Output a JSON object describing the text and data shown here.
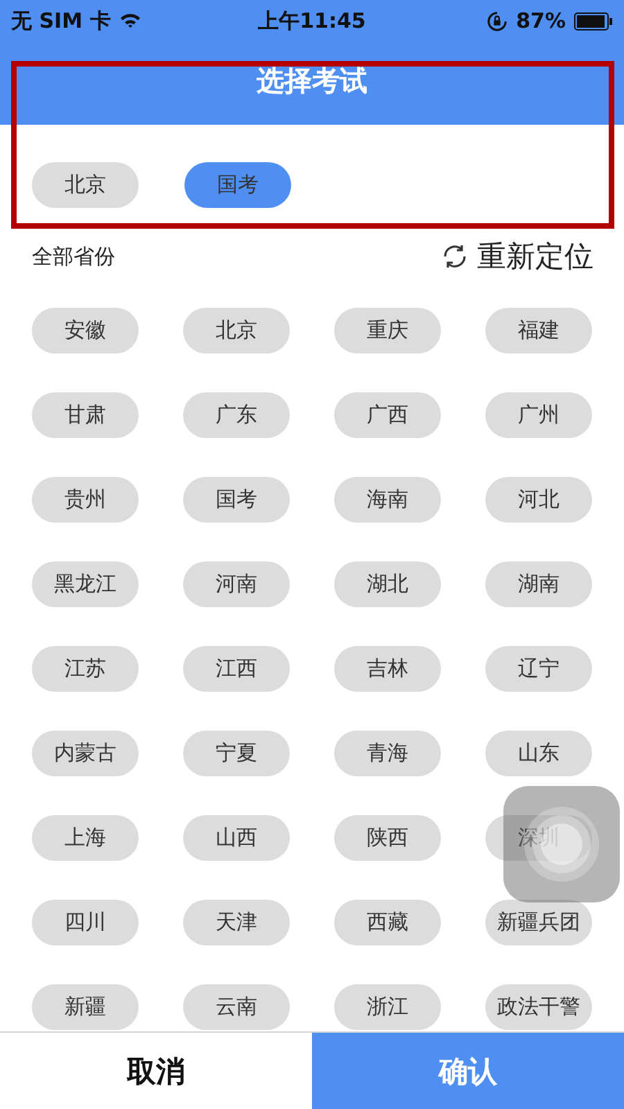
{
  "status_bar": {
    "carrier": "无 SIM 卡",
    "time": "上午11:45",
    "battery": "87%"
  },
  "header": {
    "title": "选择考试"
  },
  "picked": [
    {
      "label": "北京",
      "selected": false
    },
    {
      "label": "国考",
      "selected": true
    }
  ],
  "section": {
    "label": "全部省份",
    "relocate": "重新定位"
  },
  "regions": [
    {
      "label": "安徽",
      "selected": false
    },
    {
      "label": "北京",
      "selected": false
    },
    {
      "label": "重庆",
      "selected": false
    },
    {
      "label": "福建",
      "selected": false
    },
    {
      "label": "甘肃",
      "selected": false
    },
    {
      "label": "广东",
      "selected": false
    },
    {
      "label": "广西",
      "selected": false
    },
    {
      "label": "广州",
      "selected": false
    },
    {
      "label": "贵州",
      "selected": false
    },
    {
      "label": "国考",
      "selected": false
    },
    {
      "label": "海南",
      "selected": false
    },
    {
      "label": "河北",
      "selected": false
    },
    {
      "label": "黑龙江",
      "selected": false
    },
    {
      "label": "河南",
      "selected": false
    },
    {
      "label": "湖北",
      "selected": false
    },
    {
      "label": "湖南",
      "selected": false
    },
    {
      "label": "江苏",
      "selected": false
    },
    {
      "label": "江西",
      "selected": false
    },
    {
      "label": "吉林",
      "selected": false
    },
    {
      "label": "辽宁",
      "selected": false
    },
    {
      "label": "内蒙古",
      "selected": false
    },
    {
      "label": "宁夏",
      "selected": false
    },
    {
      "label": "青海",
      "selected": false
    },
    {
      "label": "山东",
      "selected": false
    },
    {
      "label": "上海",
      "selected": false
    },
    {
      "label": "山西",
      "selected": false
    },
    {
      "label": "陕西",
      "selected": false
    },
    {
      "label": "深圳",
      "selected": false
    },
    {
      "label": "四川",
      "selected": false
    },
    {
      "label": "天津",
      "selected": false
    },
    {
      "label": "西藏",
      "selected": false
    },
    {
      "label": "新疆兵团",
      "selected": false
    },
    {
      "label": "新疆",
      "selected": false
    },
    {
      "label": "云南",
      "selected": false
    },
    {
      "label": "浙江",
      "selected": false
    },
    {
      "label": "政法干警",
      "selected": false
    }
  ],
  "footer": {
    "cancel": "取消",
    "confirm": "确认"
  }
}
